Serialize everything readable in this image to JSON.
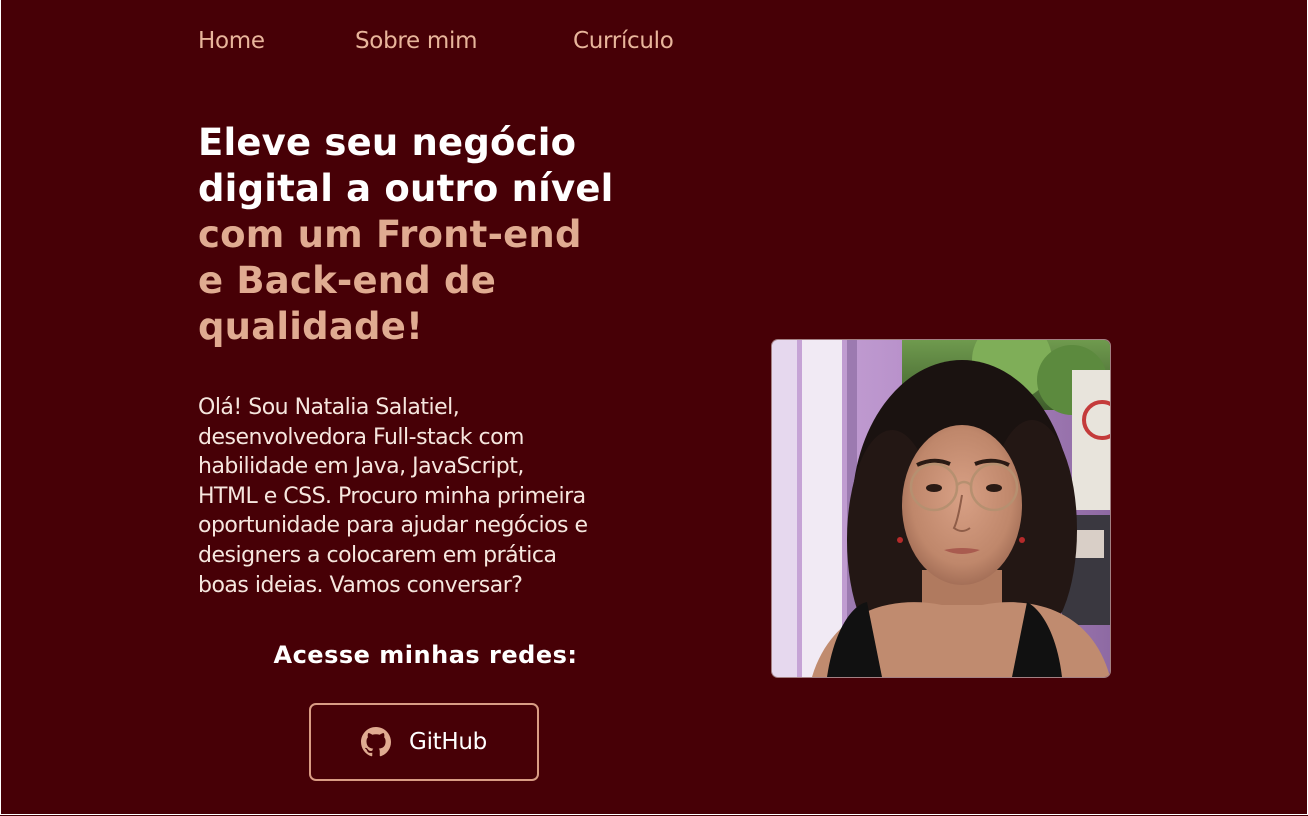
{
  "nav": {
    "items": [
      {
        "label": "Home"
      },
      {
        "label": "Sobre mim"
      },
      {
        "label": "Currículo"
      }
    ]
  },
  "hero": {
    "headline_white": [
      "Eleve seu negócio",
      "digital a outro nível"
    ],
    "headline_accent": [
      "com um Front-end",
      "e Back-end de",
      "qualidade!"
    ],
    "intro_lines": [
      "Olá! Sou Natalia Salatiel,",
      "desenvolvedora Full-stack com",
      "habilidade em Java, JavaScript,",
      "HTML e CSS. Procuro minha primeira",
      "oportunidade para ajudar negócios e",
      "designers a colocarem em prática",
      "boas ideias. Vamos conversar?"
    ]
  },
  "socials": {
    "title": "Acesse minhas redes:",
    "github_label": "GitHub",
    "github_icon": "github-icon"
  },
  "photo": {
    "icon": "profile-photo"
  },
  "colors": {
    "background": "#470006",
    "accent": "#e0ab91",
    "nav": "#e8b59b",
    "button_border": "#d99c84",
    "text_light": "#f6e6de"
  }
}
